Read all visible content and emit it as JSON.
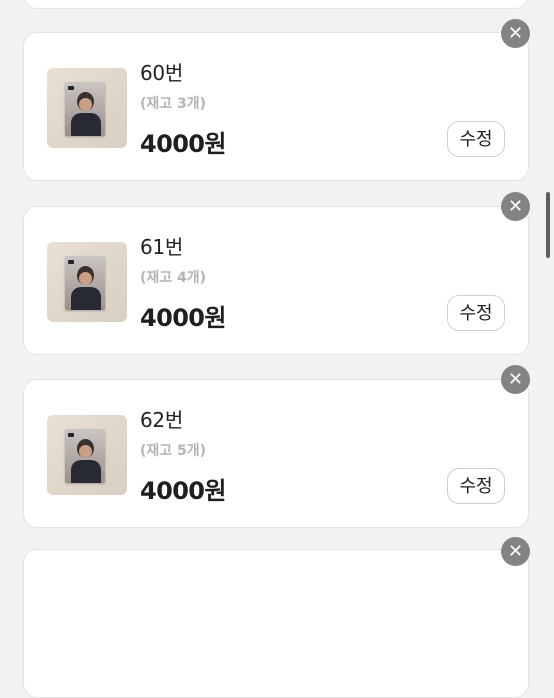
{
  "items": [
    {
      "title": "60번",
      "stock": "(재고 3개)",
      "price": "4000원",
      "edit_label": "수정",
      "delete_label": "✕"
    },
    {
      "title": "61번",
      "stock": "(재고 4개)",
      "price": "4000원",
      "edit_label": "수정",
      "delete_label": "✕"
    },
    {
      "title": "62번",
      "stock": "(재고 5개)",
      "price": "4000원",
      "edit_label": "수정",
      "delete_label": "✕"
    }
  ],
  "partial_bottom": {
    "delete_label": "✕"
  },
  "colors": {
    "background": "#f2f2f4",
    "card": "#ffffff",
    "delete_button": "#838385",
    "stock_text": "#b4b4b6",
    "scrollbar": "#5f5f62"
  },
  "icons": {
    "delete": "close-icon",
    "thumbnail": "photocard-image"
  }
}
